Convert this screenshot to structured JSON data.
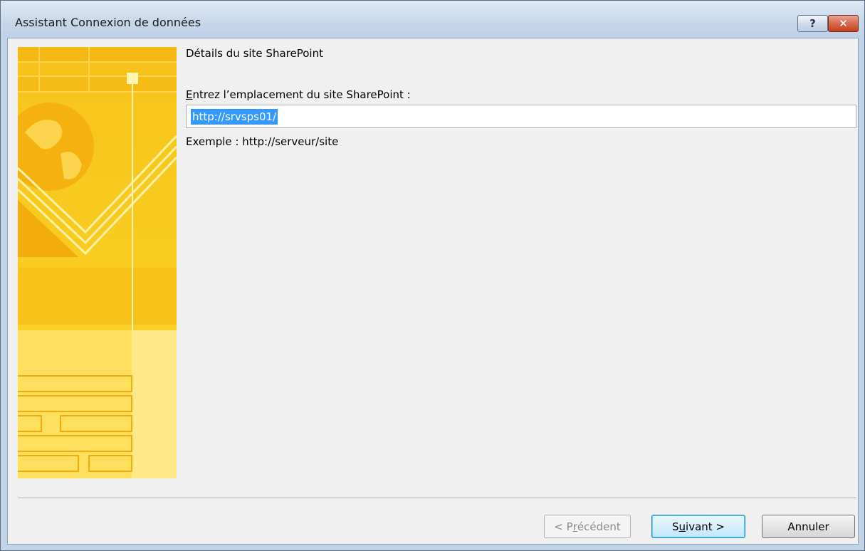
{
  "window": {
    "title": "Assistant Connexion de données",
    "help_glyph": "?",
    "close_glyph": "✕"
  },
  "content": {
    "section_title": "Détails du site SharePoint",
    "field_label_accel": "E",
    "field_label_rest": "ntrez l’emplacement du site SharePoint :",
    "url_value": "http://srvsps01/",
    "example_text": "Exemple : http://serveur/site"
  },
  "buttons": {
    "prev_pre": "< P",
    "prev_accel": "r",
    "prev_post": "écédent",
    "next_pre": "S",
    "next_accel": "u",
    "next_post": "ivant >",
    "cancel": "Annuler"
  },
  "colors": {
    "art_primary": "#f9cd22",
    "selection": "#3399ff",
    "close_button": "#c3401f"
  }
}
